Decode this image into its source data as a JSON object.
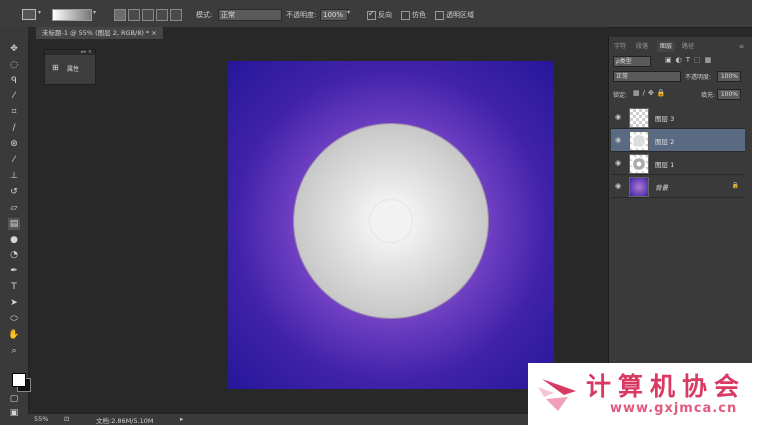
{
  "options_bar": {
    "mode_label": "模式:",
    "mode_value": "正常",
    "opacity_label": "不透明度:",
    "opacity_value": "100%",
    "reverse_label": "反向",
    "dither_label": "仿色",
    "transparency_label": "透明区域"
  },
  "document_tab": {
    "title": "未标题-1 @ 55% (图层 2, RGB/8) * ×"
  },
  "mini_panel": {
    "label": "属性"
  },
  "statusbar": {
    "zoom": "55%",
    "doc_info": "文档:2.86M/5.10M"
  },
  "layers_panel": {
    "tabs": [
      "字符",
      "段落",
      "图层",
      "路径"
    ],
    "active_tab": "图层",
    "kind_filter": "ρ类型",
    "blend_mode": "正常",
    "opacity_label": "不透明度:",
    "opacity_value": "100%",
    "lock_label": "锁定:",
    "fill_label": "填充:",
    "fill_value": "100%",
    "layers": [
      {
        "name": "图层 3",
        "thumb": "transparent",
        "selected": false
      },
      {
        "name": "图层 2",
        "thumb": "disc",
        "selected": true
      },
      {
        "name": "图层 1",
        "thumb": "disc-center",
        "selected": false
      },
      {
        "name": "背景",
        "thumb": "background",
        "selected": false,
        "locked": true
      }
    ]
  },
  "canvas": {
    "bg_inner": "#b87ad0",
    "bg_outer": "#26179a",
    "disc_color": "#cfcfcf",
    "hole_color": "#f2f2f2"
  },
  "watermark": {
    "text": "计算机协会",
    "url": "www.gxjmca.cn"
  },
  "icons": [
    "move-icon",
    "marquee-icon",
    "lasso-icon",
    "magic-wand-icon",
    "crop-icon",
    "eyedropper-icon",
    "healing-icon",
    "brush-icon",
    "stamp-icon",
    "history-brush-icon",
    "eraser-icon",
    "gradient-icon",
    "blur-icon",
    "dodge-icon",
    "pen-icon",
    "type-icon",
    "path-select-icon",
    "shape-icon",
    "hand-icon",
    "zoom-icon",
    "eye-icon",
    "lock-icon"
  ]
}
